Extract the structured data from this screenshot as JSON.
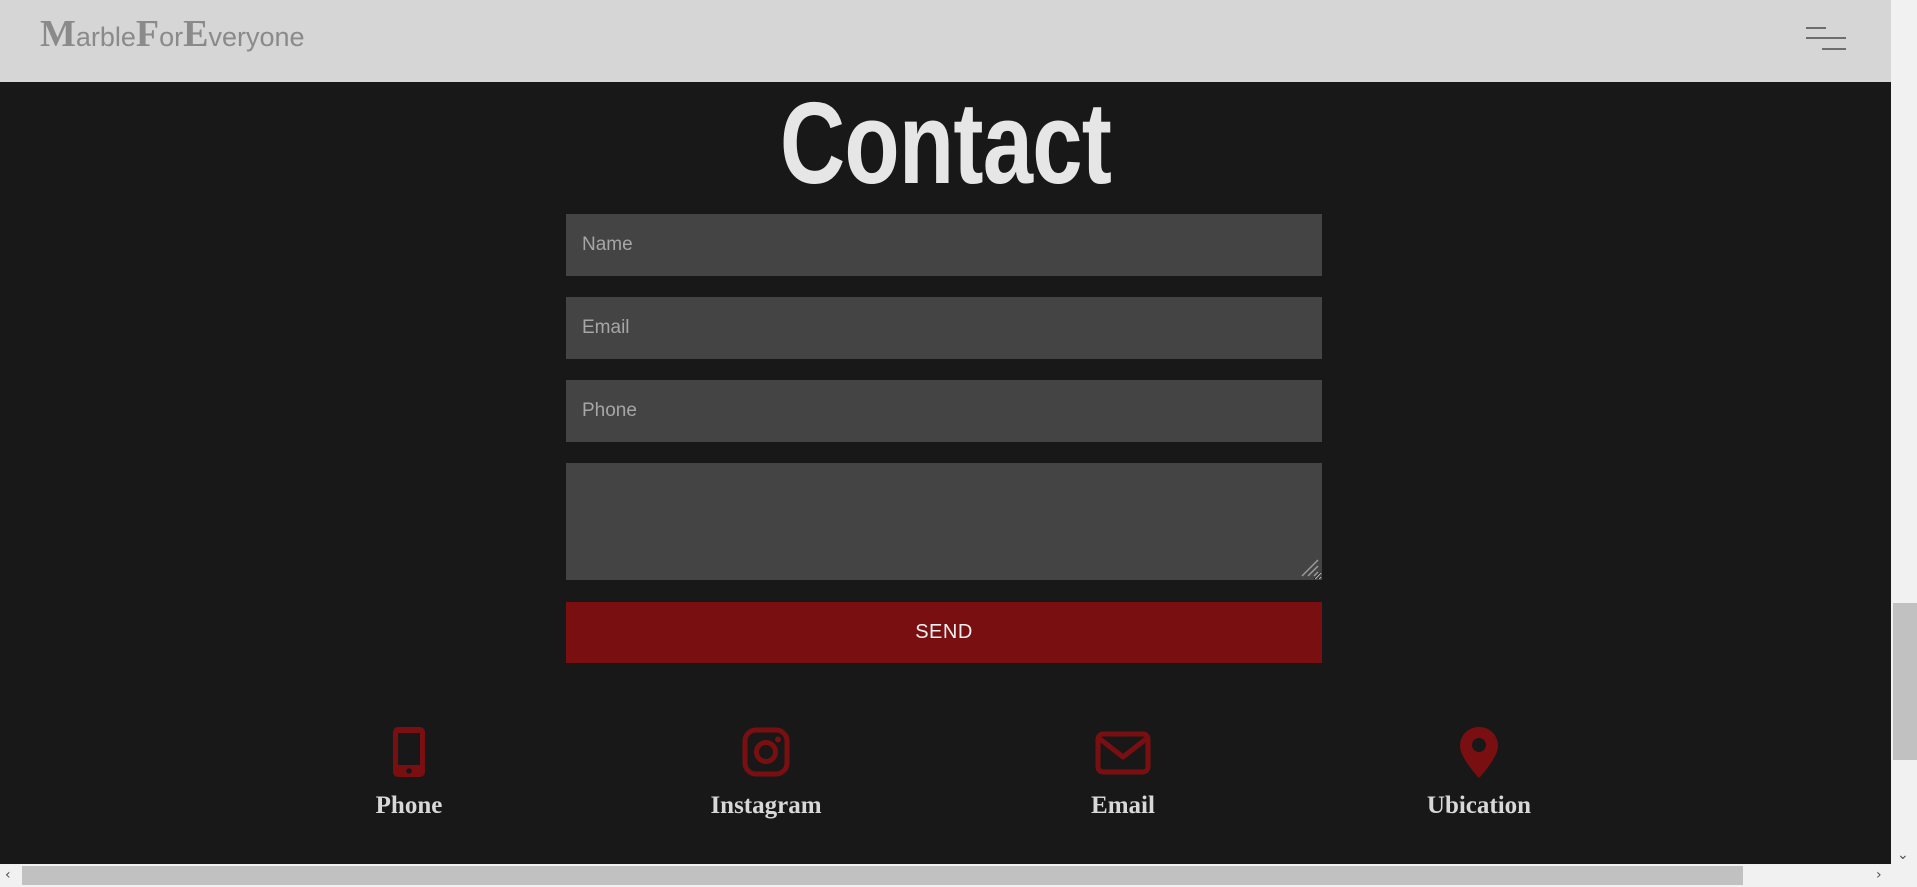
{
  "header": {
    "logo": {
      "parts": [
        {
          "cap": "M",
          "rest": "arble"
        },
        {
          "cap": "F",
          "rest": "or"
        },
        {
          "cap": "E",
          "rest": "veryone"
        }
      ]
    },
    "menu_icon": "hamburger-menu-icon"
  },
  "main": {
    "title": "Contact",
    "form": {
      "name_placeholder": "Name",
      "email_placeholder": "Email",
      "phone_placeholder": "Phone",
      "message_placeholder": "",
      "send_label": "SEND"
    },
    "contact_items": [
      {
        "label": "Phone",
        "icon": "mobile-phone-icon"
      },
      {
        "label": "Instagram",
        "icon": "instagram-icon"
      },
      {
        "label": "Email",
        "icon": "envelope-icon"
      },
      {
        "label": "Ubication",
        "icon": "map-pin-icon"
      }
    ]
  },
  "colors": {
    "header_bg": "#d6d6d6",
    "page_bg": "#181818",
    "field_bg": "#444444",
    "accent": "#7a0f11",
    "text_light": "#e6e6e6"
  }
}
